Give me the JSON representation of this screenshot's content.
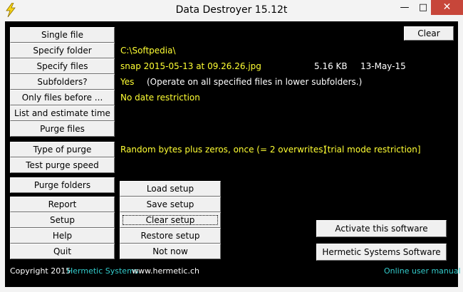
{
  "window": {
    "title": "Data Destroyer 15.12t",
    "minimize_glyph": "—",
    "maximize_glyph": "□",
    "close_glyph": "✕",
    "app_icon": "lightning-bolt-icon"
  },
  "left_buttons": {
    "single_file": "Single file",
    "specify_folder": "Specify folder",
    "specify_files": "Specify files",
    "subfolders": "Subfolders?",
    "only_files_before": "Only files before ...",
    "list_estimate": "List and estimate time",
    "purge_files": "Purge files",
    "type_of_purge": "Type of purge",
    "test_purge_speed": "Test purge speed",
    "purge_folders": "Purge folders",
    "report": "Report",
    "setup": "Setup",
    "help": "Help",
    "quit": "Quit"
  },
  "setup_buttons": {
    "load_setup": "Load setup",
    "save_setup": "Save setup",
    "clear_setup": "Clear setup",
    "restore_setup": "Restore setup",
    "not_now": "Not now"
  },
  "right_buttons": {
    "clear": "Clear",
    "activate": "Activate this software",
    "hermetic": "Hermetic Systems Software"
  },
  "info": {
    "folder": "C:\\Softpedia\\",
    "file_name": "snap 2015-05-13 at 09.26.26.jpg",
    "file_size": "5.16 KB",
    "file_date": "13-May-15",
    "subfolders_value": "Yes",
    "subfolders_note": "(Operate on all specified files in lower subfolders.)",
    "date_restriction": "No date restriction",
    "purge_type": "Random bytes plus zeros, once (= 2 overwrites)",
    "trial_note": "[trial mode restriction]"
  },
  "footer": {
    "copyright": "Copyright 2015",
    "company": "Hermetic Systems",
    "website": "www.hermetic.ch",
    "manual": "Online user manual"
  },
  "colors": {
    "background": "#000000",
    "info_text": "#ffff33",
    "link_text": "#33cccc",
    "close_button": "#c7463a"
  }
}
